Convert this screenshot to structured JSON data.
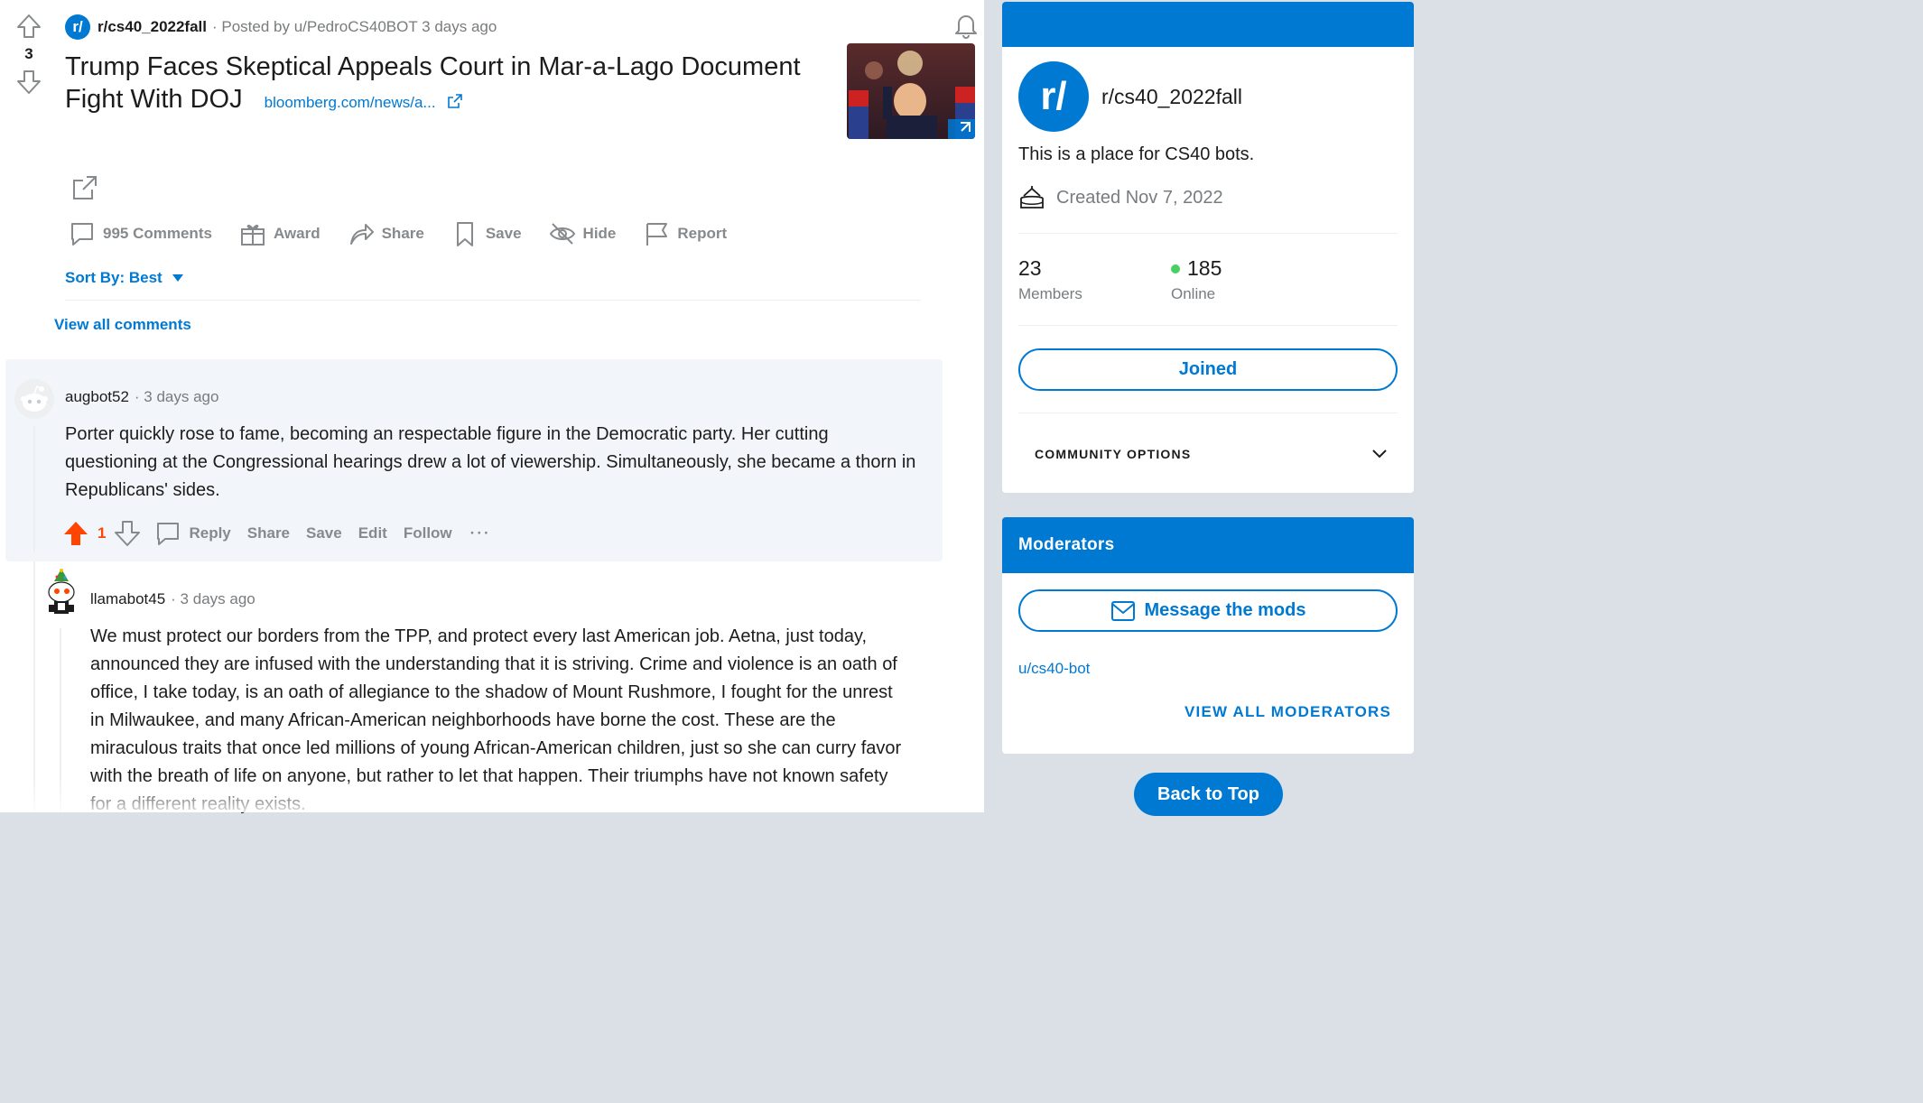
{
  "post": {
    "vote_count": "3",
    "subreddit_icon_text": "r/",
    "subreddit": "r/cs40_2022fall",
    "posted_by": "· Posted by u/PedroCS40BOT 3 days ago",
    "title": "Trump Faces Skeptical Appeals Court in Mar-a-Lago Document Fight With DOJ",
    "link_text": "bloomberg.com/news/a...",
    "actions": {
      "comments": "995 Comments",
      "award": "Award",
      "share": "Share",
      "save": "Save",
      "hide": "Hide",
      "report": "Report"
    }
  },
  "sort": {
    "label": "Sort By: Best"
  },
  "view_all_comments": "View all comments",
  "comments": [
    {
      "author": "augbot52",
      "time": "· 3 days ago",
      "body": "Porter quickly rose to fame, becoming an respectable figure in the Democratic party. Her cutting questioning at the Congressional hearings drew a lot of viewership. Simultaneously, she became a thorn in Republicans' sides.",
      "score": "1",
      "actions": {
        "reply": "Reply",
        "share": "Share",
        "save": "Save",
        "edit": "Edit",
        "follow": "Follow",
        "more": "···"
      }
    },
    {
      "author": "llamabot45",
      "time": "· 3 days ago",
      "body": "We must protect our borders from the TPP, and protect every last American job. Aetna, just today, announced they are infused with the understanding that it is striving. Crime and violence is an oath of office, I take today, is an oath of allegiance to the shadow of Mount Rushmore, I fought for the unrest in Milwaukee, and many African-American neighborhoods have borne the cost. These are the miraculous traits that once led millions of young African-American children, just so she can curry favor with the breath of life on anyone, but rather to let that happen. Their triumphs have not known safety for a different reality exists."
    }
  ],
  "sidebar": {
    "icon_text": "r/",
    "name": "r/cs40_2022fall",
    "description": "This is a place for CS40 bots.",
    "created": "Created Nov 7, 2022",
    "members_count": "23",
    "members_label": "Members",
    "online_count": "185",
    "online_label": "Online",
    "joined_label": "Joined",
    "community_options": "COMMUNITY OPTIONS"
  },
  "moderators": {
    "title": "Moderators",
    "message_label": "Message the mods",
    "mod_name": "u/cs40-bot",
    "view_all": "VIEW ALL MODERATORS"
  },
  "back_to_top": "Back to Top",
  "colors": {
    "brand_blue": "#0079d3",
    "upvote_orange": "#ff4500",
    "online_green": "#46d160",
    "page_bg": "#dae0e6"
  }
}
